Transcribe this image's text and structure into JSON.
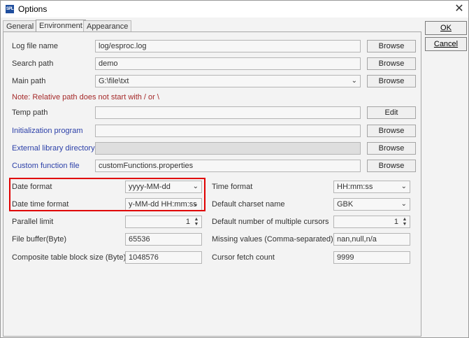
{
  "window": {
    "title": "Options",
    "app_icon_text": "SPL"
  },
  "tabs": [
    {
      "label": "General"
    },
    {
      "label": "Environment"
    },
    {
      "label": "Appearance"
    }
  ],
  "side_buttons": {
    "ok": "OK",
    "cancel": "Cancel"
  },
  "env": {
    "log_file": {
      "label": "Log file name",
      "value": "log/esproc.log",
      "button": "Browse"
    },
    "search_path": {
      "label": "Search path",
      "value": "demo",
      "button": "Browse"
    },
    "main_path": {
      "label": "Main path",
      "value": "G:\\file\\txt",
      "button": "Browse"
    },
    "note": "Note: Relative path does not start with / or \\",
    "temp_path": {
      "label": "Temp path",
      "value": "",
      "button": "Edit"
    },
    "init_program": {
      "label": "Initialization program",
      "value": "",
      "button": "Browse"
    },
    "ext_lib": {
      "label": "External library directory",
      "value": "",
      "button": "Browse"
    },
    "custom_func": {
      "label": "Custom function file",
      "value": "customFunctions.properties",
      "button": "Browse"
    }
  },
  "formats": {
    "date_format": {
      "label": "Date format",
      "value": "yyyy-MM-dd"
    },
    "datetime_format": {
      "label": "Date time format",
      "value": "y-MM-dd HH:mm:ss"
    },
    "parallel_limit": {
      "label": "Parallel limit",
      "value": "1"
    },
    "file_buffer": {
      "label": "File buffer(Byte)",
      "value": "65536"
    },
    "block_size": {
      "label": "Composite table block size (Byte)",
      "value": "1048576"
    },
    "time_format": {
      "label": "Time format",
      "value": "HH:mm:ss"
    },
    "charset": {
      "label": "Default charset name",
      "value": "GBK"
    },
    "cursors": {
      "label": "Default number of multiple cursors",
      "value": "1"
    },
    "missing_values": {
      "label": "Missing values (Comma-separated)",
      "value": "nan,null,n/a"
    },
    "fetch_count": {
      "label": "Cursor fetch count",
      "value": "9999"
    }
  },
  "icons": {
    "close": "close-icon",
    "dropdown": "chevron-down-icon",
    "spinner": "spinner-arrows-icon"
  },
  "colors": {
    "highlight": "#e00000",
    "link_label": "#2b3fa8",
    "note": "#a52a2a"
  }
}
